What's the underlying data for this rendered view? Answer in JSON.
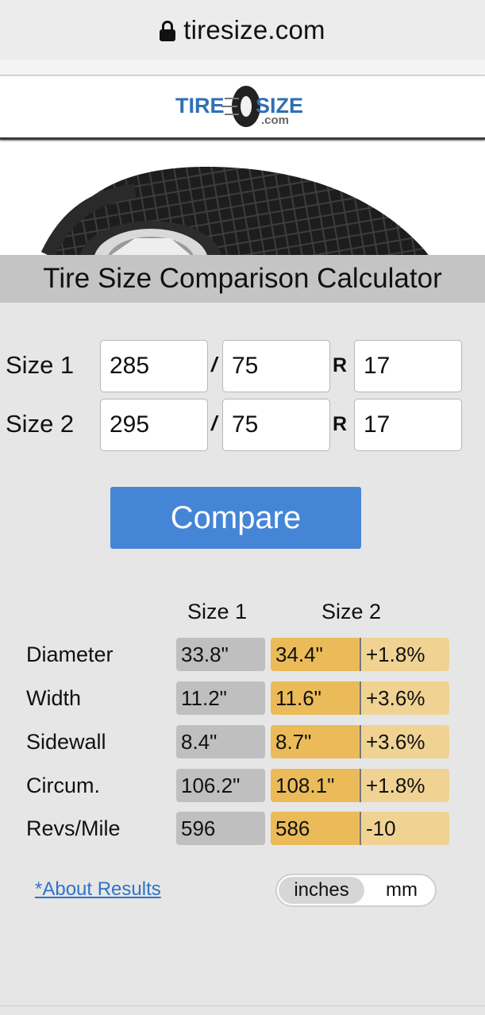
{
  "browser": {
    "url": "tiresize.com",
    "lock_icon": "lock-icon"
  },
  "logo": {
    "brand": "TIRESIZE",
    "sub": ".com",
    "colors": {
      "blue": "#2f6fb5",
      "dark": "#222222"
    }
  },
  "calculator": {
    "title": "Tire Size Comparison Calculator",
    "size1": {
      "label": "Size 1",
      "width": "285",
      "slash": "/",
      "aspect": "75",
      "r": "R",
      "rim": "17"
    },
    "size2": {
      "label": "Size 2",
      "width": "295",
      "slash": "/",
      "aspect": "75",
      "r": "R",
      "rim": "17"
    },
    "compare_label": "Compare"
  },
  "results": {
    "col_size1": "Size 1",
    "col_size2": "Size 2",
    "rows": [
      {
        "label": "Diameter",
        "s1": "33.8\"",
        "s2": "34.4\"",
        "diff": "+1.8%"
      },
      {
        "label": "Width",
        "s1": "11.2\"",
        "s2": "11.6\"",
        "diff": "+3.6%"
      },
      {
        "label": "Sidewall",
        "s1": "8.4\"",
        "s2": "8.7\"",
        "diff": "+3.6%"
      },
      {
        "label": "Circum.",
        "s1": "106.2\"",
        "s2": "108.1\"",
        "diff": "+1.8%"
      },
      {
        "label": "Revs/Mile",
        "s1": "596",
        "s2": "586",
        "diff": "-10"
      }
    ],
    "colors": {
      "size1_bg": "#bfbfbf",
      "size2_bg": "#ebbb59",
      "diff_bg": "#f0d393"
    }
  },
  "footer": {
    "about_link": "*About Results",
    "unit_inches": "inches",
    "unit_mm": "mm",
    "selected_unit": "inches"
  },
  "theme": {
    "accent": "#4585d6",
    "title_band": "#c4c4c4",
    "page_bg": "#e6e6e6"
  }
}
